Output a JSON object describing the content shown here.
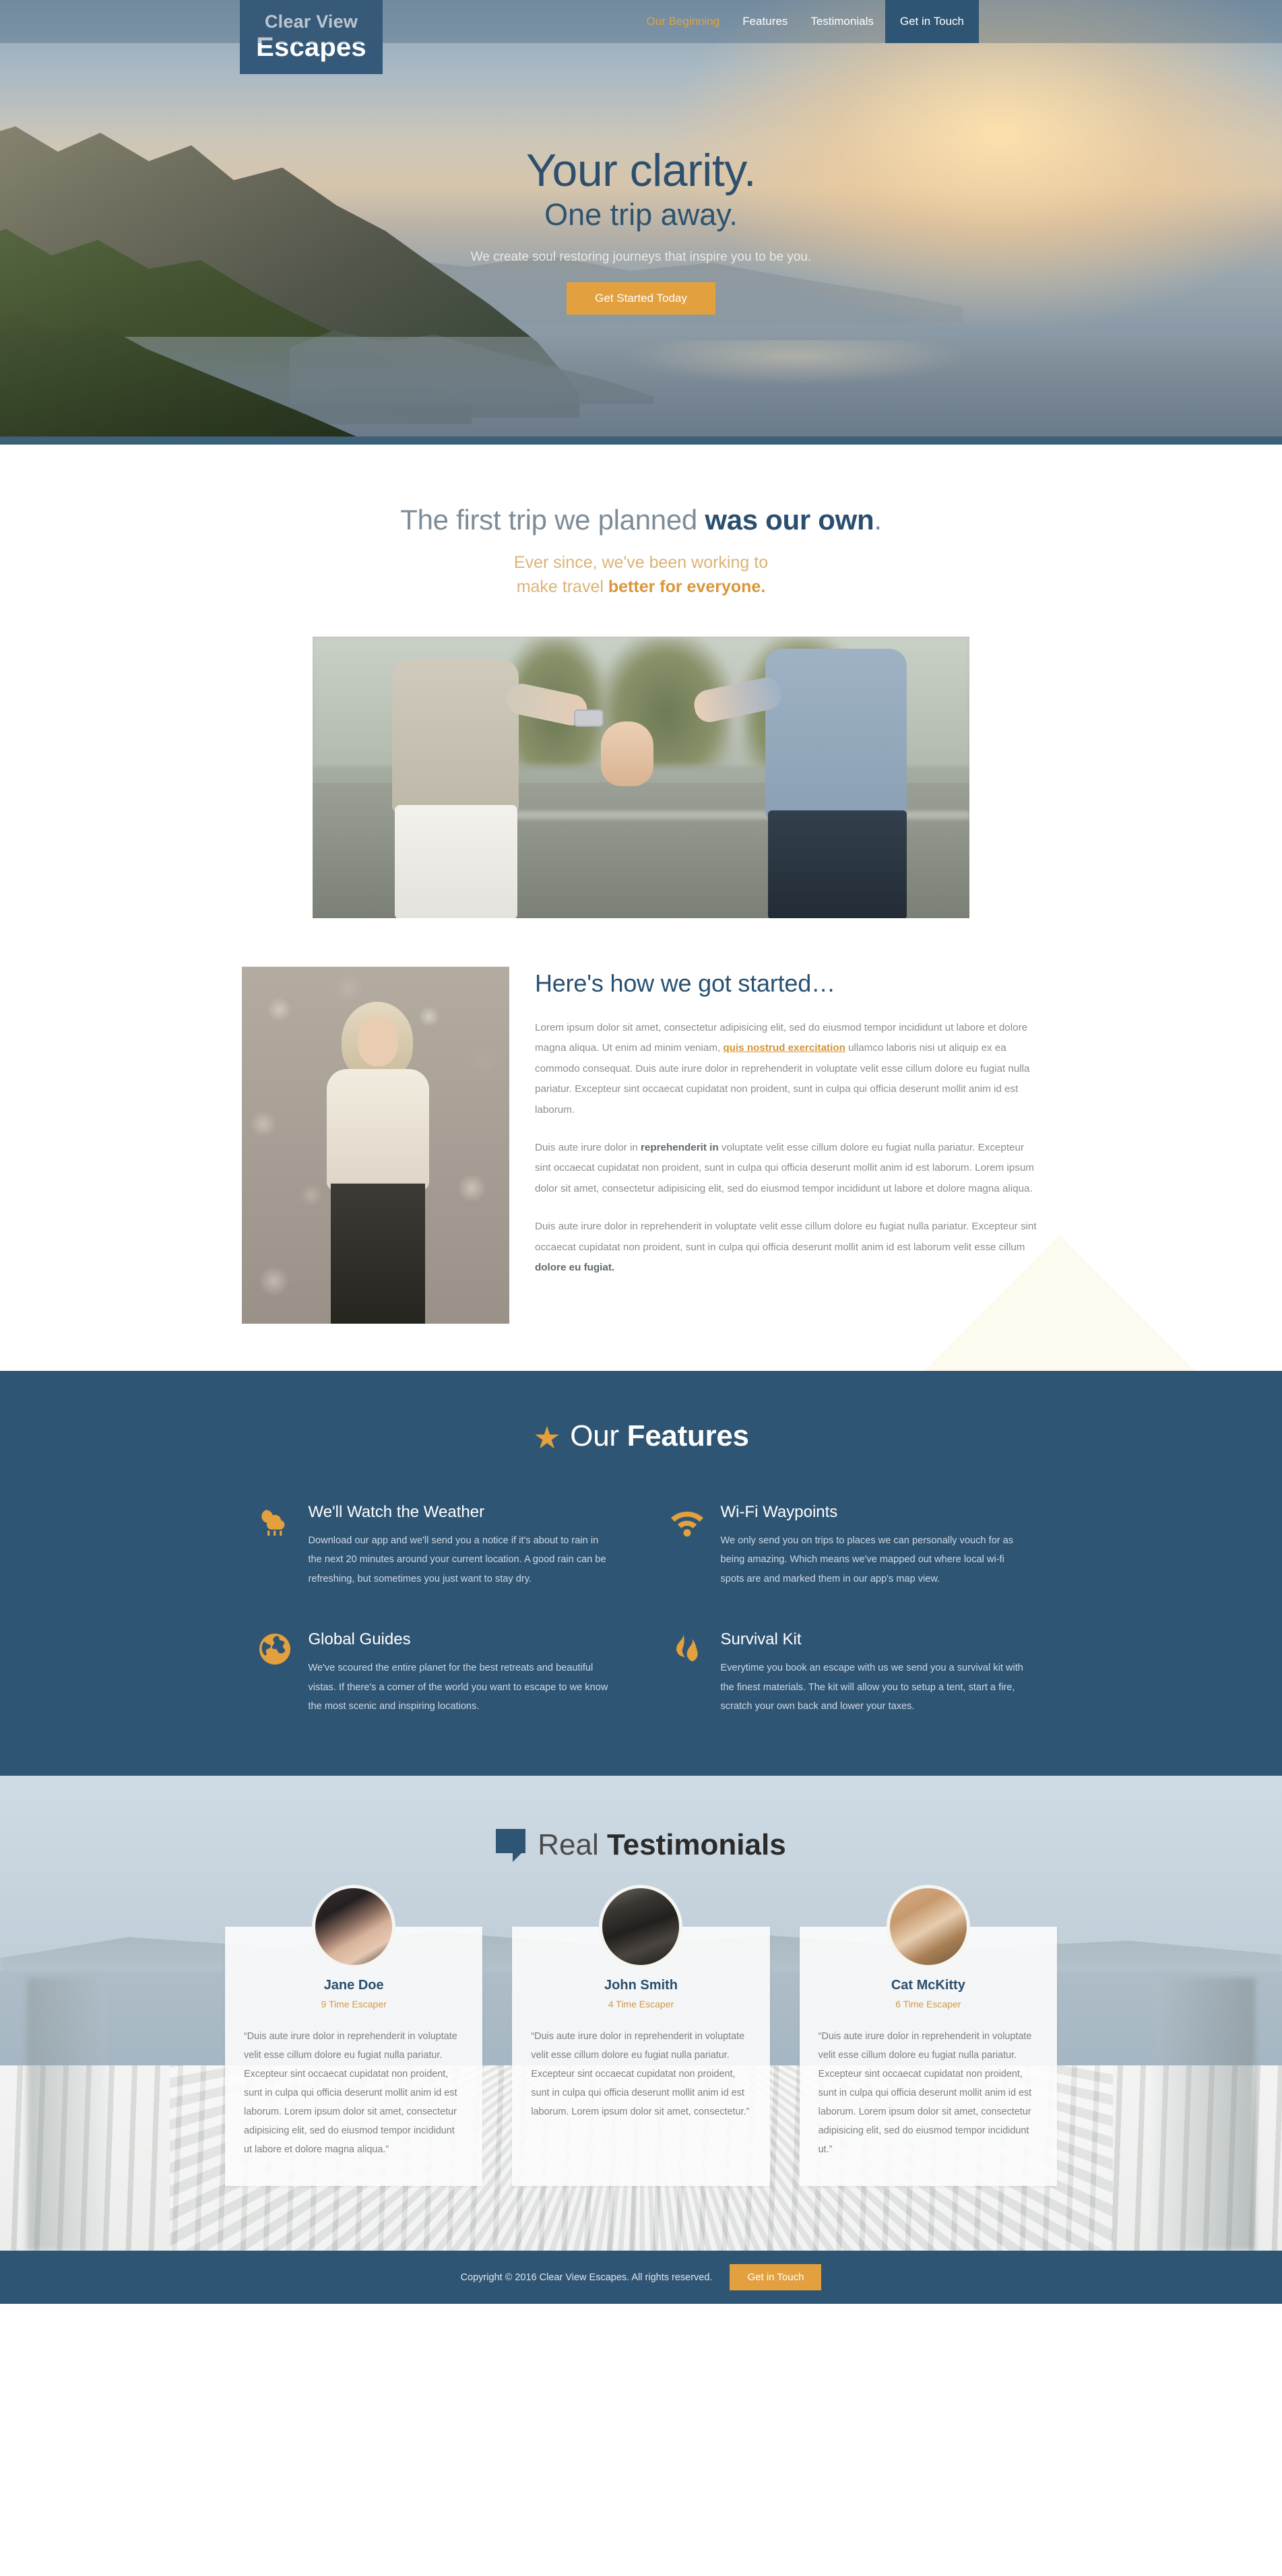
{
  "brand": {
    "logo_line1": "Clear View",
    "logo_line2": "Escapes"
  },
  "nav": {
    "items": [
      {
        "label": "Our Beginning",
        "active": true
      },
      {
        "label": "Features",
        "active": false
      },
      {
        "label": "Testimonials",
        "active": false
      }
    ],
    "cta_label": "Get in Touch"
  },
  "hero": {
    "heading_line1": "Your clarity.",
    "heading_line2": "One trip away.",
    "subtext": "We create soul restoring journeys that inspire you to be you.",
    "cta_label": "Get Started Today"
  },
  "beginning": {
    "title_light": "The first trip we planned ",
    "title_bold": "was our own",
    "title_end": ".",
    "subtitle_line1": "Ever since, we've been working to",
    "subtitle_line2_light": "make travel ",
    "subtitle_line2_bold": "better for everyone.",
    "photo_alt": "couple-holding-hands-photo"
  },
  "story": {
    "photo_alt": "woman-standing-by-rocks-photo",
    "heading": "Here's how we got started…",
    "p1_a": "Lorem ipsum dolor sit amet, consectetur adipisicing elit, sed do eiusmod tempor incididunt ut labore et dolore magna aliqua. Ut enim ad minim veniam, ",
    "p1_link": "quis nostrud exercitation",
    "p1_b": " ullamco laboris nisi ut aliquip ex ea commodo consequat. Duis aute irure dolor in reprehenderit in voluptate velit esse cillum dolore eu fugiat nulla pariatur. Excepteur sint occaecat cupidatat non proident, sunt in culpa qui officia deserunt mollit anim id est laborum.",
    "p2_a": "Duis aute irure dolor in ",
    "p2_bold": "reprehenderit in",
    "p2_b": " voluptate velit esse cillum dolore eu fugiat nulla pariatur. Excepteur sint occaecat cupidatat non proident, sunt in culpa qui officia deserunt mollit anim id est laborum. Lorem ipsum dolor sit amet, consectetur adipisicing elit, sed do eiusmod tempor incididunt ut labore et dolore magna aliqua.",
    "p3_a": "Duis aute irure dolor in reprehenderit in voluptate velit esse cillum dolore eu fugiat nulla pariatur. Excepteur sint occaecat cupidatat non proident, sunt in culpa qui officia deserunt mollit anim id est laborum velit esse cillum ",
    "p3_bold": "dolore eu fugiat."
  },
  "features": {
    "star_icon": "star-icon",
    "title_light": "Our ",
    "title_bold": "Features",
    "items": [
      {
        "icon": "rain-cloud-icon",
        "title": "We'll Watch the Weather",
        "text": "Download our app and we'll send you a notice if it's about to rain in the next 20 minutes around your current location. A good rain can be refreshing, but sometimes you just want to stay dry."
      },
      {
        "icon": "wifi-icon",
        "title": "Wi-Fi Waypoints",
        "text": "We only send you on trips to places we can personally vouch for as being amazing. Which means we've mapped out where local wi-fi spots are and marked them in our app's map view."
      },
      {
        "icon": "globe-icon",
        "title": "Global Guides",
        "text": "We've scoured the entire planet for the best retreats and beautiful vistas. If there's a corner of the world you want to escape to we know the most scenic and inspiring locations."
      },
      {
        "icon": "flame-icon",
        "title": "Survival Kit",
        "text": "Everytime you book an escape with us we send you a survival kit with the finest materials. The kit will allow you to setup a tent, start a fire, scratch your own back and lower your taxes."
      }
    ]
  },
  "testimonials": {
    "bubble_icon": "speech-bubble-icon",
    "title_light": "Real ",
    "title_bold": "Testimonials",
    "cards": [
      {
        "avatar": "avatar-jane-doe",
        "name": "Jane Doe",
        "role": "9 Time Escaper",
        "quote": "“Duis aute irure dolor in reprehenderit in voluptate velit esse cillum dolore eu fugiat nulla pariatur. Excepteur sint occaecat cupidatat non proident, sunt in culpa qui officia deserunt mollit anim id est laborum. Lorem ipsum dolor sit amet, consectetur adipisicing elit, sed do eiusmod tempor incididunt ut labore et dolore magna aliqua.”"
      },
      {
        "avatar": "avatar-john-smith",
        "name": "John Smith",
        "role": "4 Time Escaper",
        "quote": "“Duis aute irure dolor in reprehenderit in voluptate velit esse cillum dolore eu fugiat nulla pariatur. Excepteur sint occaecat cupidatat non proident, sunt in culpa qui officia deserunt mollit anim id est laborum. Lorem ipsum dolor sit amet, consectetur.”"
      },
      {
        "avatar": "avatar-cat-mckitty",
        "name": "Cat McKitty",
        "role": "6 Time Escaper",
        "quote": "“Duis aute irure dolor in reprehenderit in voluptate velit esse cillum dolore eu fugiat nulla pariatur. Excepteur sint occaecat cupidatat non proident, sunt in culpa qui officia deserunt mollit anim id est laborum. Lorem ipsum dolor sit amet, consectetur adipisicing elit, sed do eiusmod tempor incididunt ut.”"
      }
    ]
  },
  "footer": {
    "copyright": "Copyright © 2016 Clear View Escapes. All rights reserved.",
    "cta_label": "Get in Touch"
  },
  "colors": {
    "brand_blue": "#2f5574",
    "brand_blue_dark": "#2a4f6e",
    "accent_orange": "#e2a03f",
    "accent_orange_soft": "#d29a45",
    "muted_text": "#878d92"
  }
}
